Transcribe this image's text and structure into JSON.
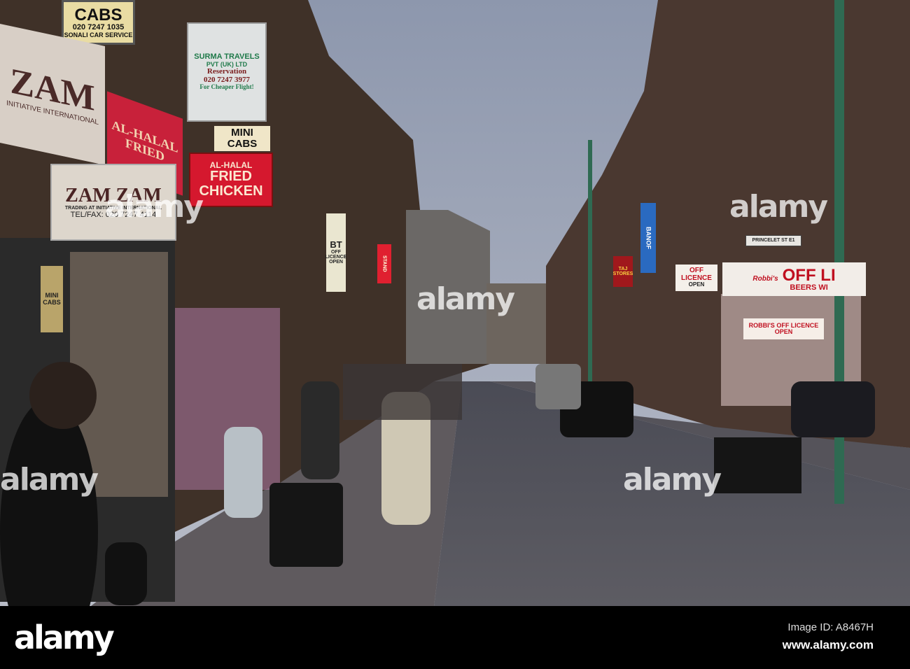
{
  "photo": {
    "signs": {
      "cabs": {
        "title": "CABS",
        "phone": "020 7247 1035",
        "sub": "SONALI CAR SERVICE"
      },
      "surma": {
        "title": "SURMA TRAVELS",
        "sub": "PVT (UK) LTD",
        "line1": "Reservation",
        "phone": "020 7247 3977",
        "line2": "For Cheaper Flight!"
      },
      "zam_awning": {
        "title": "ZAM",
        "sub": "INITIATIVE INTERNATIONAL"
      },
      "alhalal_awning": {
        "title": "AL-HALAL FRIED"
      },
      "mini_cabs": {
        "line1": "MINI",
        "line2": "CABS"
      },
      "fried_chicken": {
        "line1": "AL-HALAL",
        "line2": "FRIED",
        "line3": "CHICKEN"
      },
      "zamzam": {
        "title": "ZAM ZAM",
        "sub": "TRADING AT INITIATIVE INTERNATIONAL",
        "phone": "TEL/FAX: 020 7247 4114"
      },
      "mini_cabs_window": "MINI CABS",
      "bt": {
        "line1": "BT",
        "line2": "OFF LICENCE OPEN"
      },
      "stand": "STAND",
      "off_licence_small": {
        "line1": "OFF",
        "line2": "LICENCE",
        "line3": "OPEN"
      },
      "robbis": {
        "brand": "Robbi's",
        "title": "OFF LI",
        "sub": "BEERS WI"
      },
      "robbis_window": "ROBBI'S OFF LICENCE OPEN",
      "taj": "TAJ STORES",
      "banof": "BANOF",
      "princelet": "PRINCELET ST E1"
    },
    "watermark": "alamy"
  },
  "footer": {
    "logo": "alamy",
    "image_id": "Image ID: A8467H",
    "website": "www.alamy.com"
  }
}
